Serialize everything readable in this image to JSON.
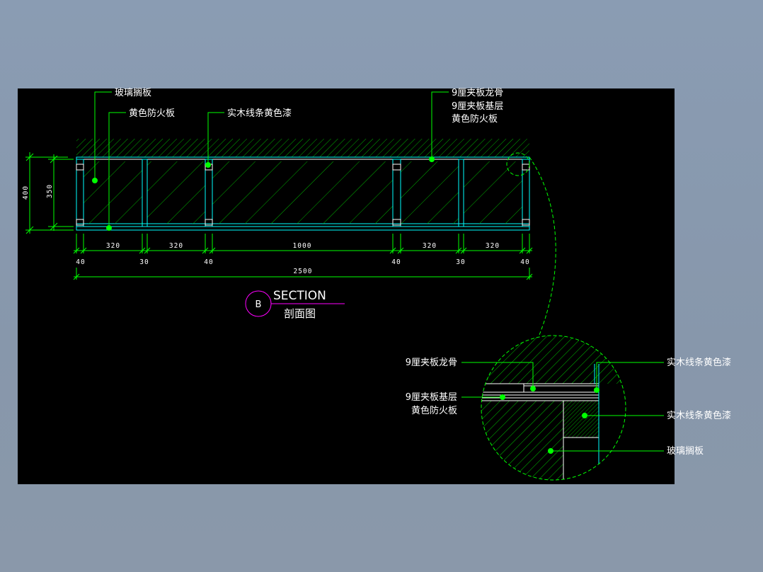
{
  "labels": {
    "glass_shelf": "玻璃搁板",
    "yellow_fireboard": "黄色防火板",
    "solid_wood_strip": "实木线条黄色漆",
    "ply_keel": "9厘夹板龙骨",
    "ply_base": "9厘夹板基层",
    "yellow_fireboard_2": "黄色防火板"
  },
  "dimensions": {
    "h400": "400",
    "h350": "350",
    "w320a": "320",
    "w320b": "320",
    "w1000": "1000",
    "w320c": "320",
    "w320d": "320",
    "t40a": "40",
    "t30a": "30",
    "t40b": "40",
    "t40c": "40",
    "t30b": "30",
    "t40d": "40",
    "total": "2500"
  },
  "section": {
    "tag": "B",
    "title": "SECTION",
    "subtitle": "剖面图"
  },
  "detail": {
    "ply_keel": "9厘夹板龙骨",
    "ply_base": "9厘夹板基层",
    "yellow_fireboard": "黄色防火板",
    "solid_wood_strip_1": "实木线条黄色漆",
    "solid_wood_strip_2": "实木线条黄色漆",
    "glass_shelf": "玻璃搁板"
  },
  "colors": {
    "outline": "#00ffff",
    "leader": "#00ff00",
    "hatch": "#00c000",
    "section_circle": "#ff00ff",
    "text": "#ffffff"
  }
}
